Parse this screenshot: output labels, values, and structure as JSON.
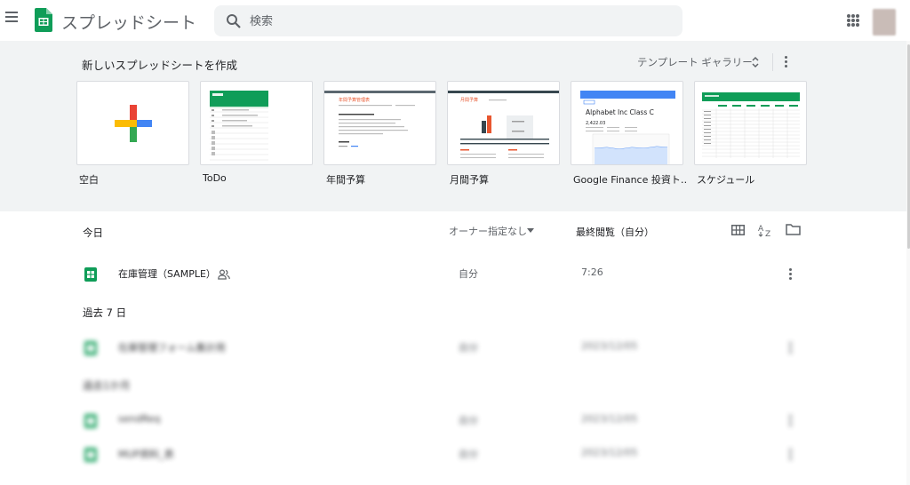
{
  "header": {
    "app_title": "スプレッドシート",
    "search_placeholder": "検索",
    "brand_green": "#0f9d58"
  },
  "templates": {
    "heading": "新しいスプレッドシートを作成",
    "gallery_label": "テンプレート ギャラリー",
    "items": [
      {
        "label": "空白",
        "thumb": "blank-plus"
      },
      {
        "label": "ToDo",
        "thumb": "todo"
      },
      {
        "label": "年間予算",
        "thumb": "annual-budget",
        "inner_title": "年間予算管理表"
      },
      {
        "label": "月間予算",
        "thumb": "monthly-budget",
        "inner_title": "月間予算"
      },
      {
        "label": "Google Finance 投資ト…",
        "thumb": "finance",
        "inner_title": "Alphabet Inc Class C",
        "inner_value": "2,422.03"
      },
      {
        "label": "スケジュール",
        "thumb": "schedule"
      }
    ]
  },
  "list": {
    "today_label": "今日",
    "owner_filter": "オーナー指定なし",
    "sort_label": "最終閲覧（自分）",
    "files_today": [
      {
        "name": "在庫管理（SAMPLE）",
        "owner": "自分",
        "date": "7:26",
        "shared": true
      }
    ],
    "past7_label": "過去 7 日",
    "files_past7": [
      {
        "name": "在庫管理フォーム集計用",
        "owner": "自分",
        "date": "2023/12/05",
        "shared": true
      }
    ],
    "earlier_label": "過去1か月",
    "files_earlier": [
      {
        "name": "sendReq",
        "owner": "自分",
        "date": "2023/12/05",
        "shared": false
      },
      {
        "name": "MUP資料_表",
        "owner": "自分",
        "date": "2023/12/05",
        "shared": false
      }
    ]
  }
}
